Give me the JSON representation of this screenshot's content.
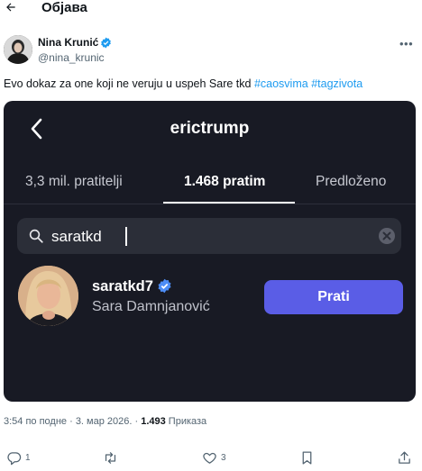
{
  "header": {
    "title": "Објава"
  },
  "post": {
    "author_name": "Nina Krunić",
    "author_handle": "@nina_krunic",
    "text": "Evo dokaz za one koji ne veruju u uspeh Sare tkd ",
    "hashtags": [
      "#caosvima",
      "#tagzivota"
    ],
    "time": "3:54 по подне · 3. мар 2026. · ",
    "views_count": "1.493",
    "views_label": " Приказа"
  },
  "screenshot": {
    "title": "erictrump",
    "tabs": [
      "3,3 mil. pratitelji",
      "1.468 pratim",
      "Predloženo"
    ],
    "active_tab_index": 1,
    "search_value": "saratkd",
    "result": {
      "username": "saratkd7",
      "full_name": "Sara Damnjanović",
      "follow_label": "Prati"
    }
  },
  "actions": {
    "reply_count": "1",
    "repost_count": "",
    "like_count": "3"
  },
  "colors": {
    "accent": "#1d9bf0",
    "dark_bg": "#181a24",
    "follow_button": "#5a5de6",
    "verified": "#1d9bf0"
  },
  "icons": [
    "back-arrow-icon",
    "verified-icon",
    "more-icon",
    "search-icon",
    "clear-icon",
    "reply-icon",
    "repost-icon",
    "like-icon",
    "bookmark-icon",
    "share-icon"
  ]
}
